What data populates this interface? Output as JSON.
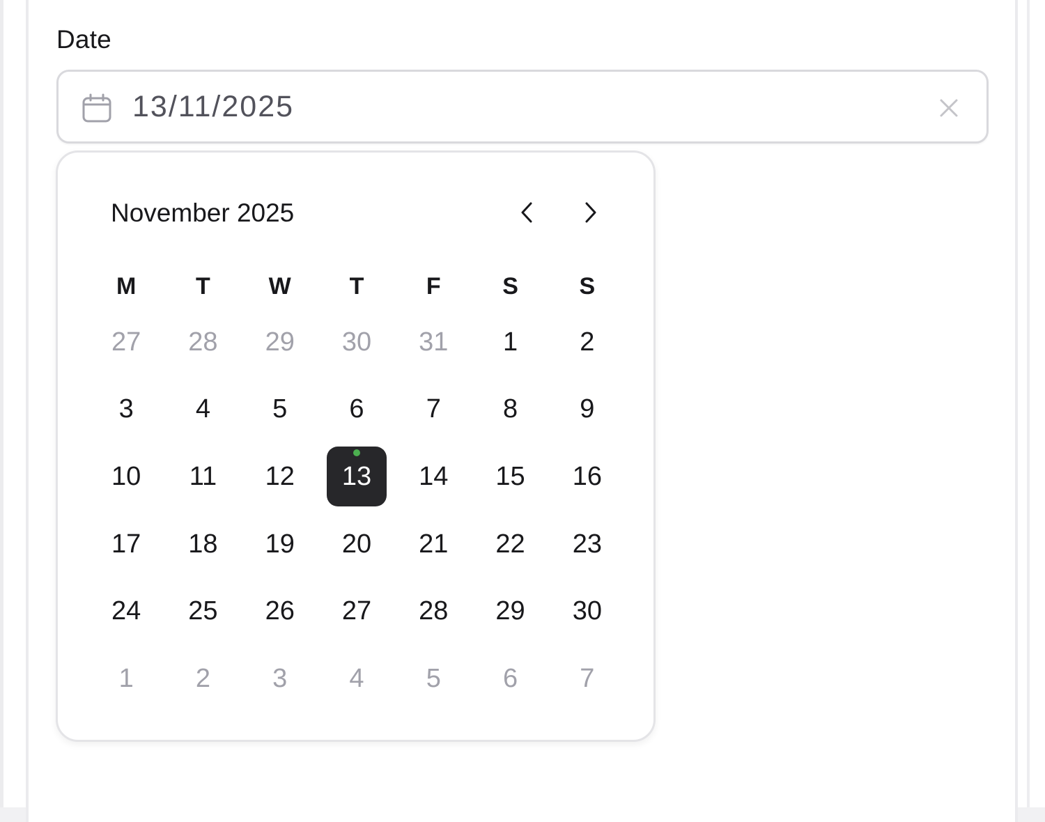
{
  "field": {
    "label": "Date",
    "value": "13/11/2025"
  },
  "calendar": {
    "month_title": "November 2025",
    "weekdays": [
      "M",
      "T",
      "W",
      "T",
      "F",
      "S",
      "S"
    ],
    "weeks": [
      [
        {
          "d": "27",
          "outside": true
        },
        {
          "d": "28",
          "outside": true
        },
        {
          "d": "29",
          "outside": true
        },
        {
          "d": "30",
          "outside": true
        },
        {
          "d": "31",
          "outside": true
        },
        {
          "d": "1",
          "outside": false
        },
        {
          "d": "2",
          "outside": false
        }
      ],
      [
        {
          "d": "3",
          "outside": false
        },
        {
          "d": "4",
          "outside": false
        },
        {
          "d": "5",
          "outside": false
        },
        {
          "d": "6",
          "outside": false
        },
        {
          "d": "7",
          "outside": false
        },
        {
          "d": "8",
          "outside": false
        },
        {
          "d": "9",
          "outside": false
        }
      ],
      [
        {
          "d": "10",
          "outside": false
        },
        {
          "d": "11",
          "outside": false
        },
        {
          "d": "12",
          "outside": false
        },
        {
          "d": "13",
          "outside": false,
          "selected": true,
          "today": true
        },
        {
          "d": "14",
          "outside": false
        },
        {
          "d": "15",
          "outside": false
        },
        {
          "d": "16",
          "outside": false
        }
      ],
      [
        {
          "d": "17",
          "outside": false
        },
        {
          "d": "18",
          "outside": false
        },
        {
          "d": "19",
          "outside": false
        },
        {
          "d": "20",
          "outside": false
        },
        {
          "d": "21",
          "outside": false
        },
        {
          "d": "22",
          "outside": false
        },
        {
          "d": "23",
          "outside": false
        }
      ],
      [
        {
          "d": "24",
          "outside": false
        },
        {
          "d": "25",
          "outside": false
        },
        {
          "d": "26",
          "outside": false
        },
        {
          "d": "27",
          "outside": false
        },
        {
          "d": "28",
          "outside": false
        },
        {
          "d": "29",
          "outside": false
        },
        {
          "d": "30",
          "outside": false
        }
      ],
      [
        {
          "d": "1",
          "outside": true
        },
        {
          "d": "2",
          "outside": true
        },
        {
          "d": "3",
          "outside": true
        },
        {
          "d": "4",
          "outside": true
        },
        {
          "d": "5",
          "outside": true
        },
        {
          "d": "6",
          "outside": true
        },
        {
          "d": "7",
          "outside": true
        }
      ]
    ]
  },
  "icons": {
    "field_icon": "calendar-icon",
    "clear": "close-icon",
    "prev": "chevron-left-icon",
    "next": "chevron-right-icon"
  },
  "colors": {
    "selected_bg": "#27272a",
    "today_dot": "#4caf50",
    "outside_day": "#a1a1aa"
  }
}
